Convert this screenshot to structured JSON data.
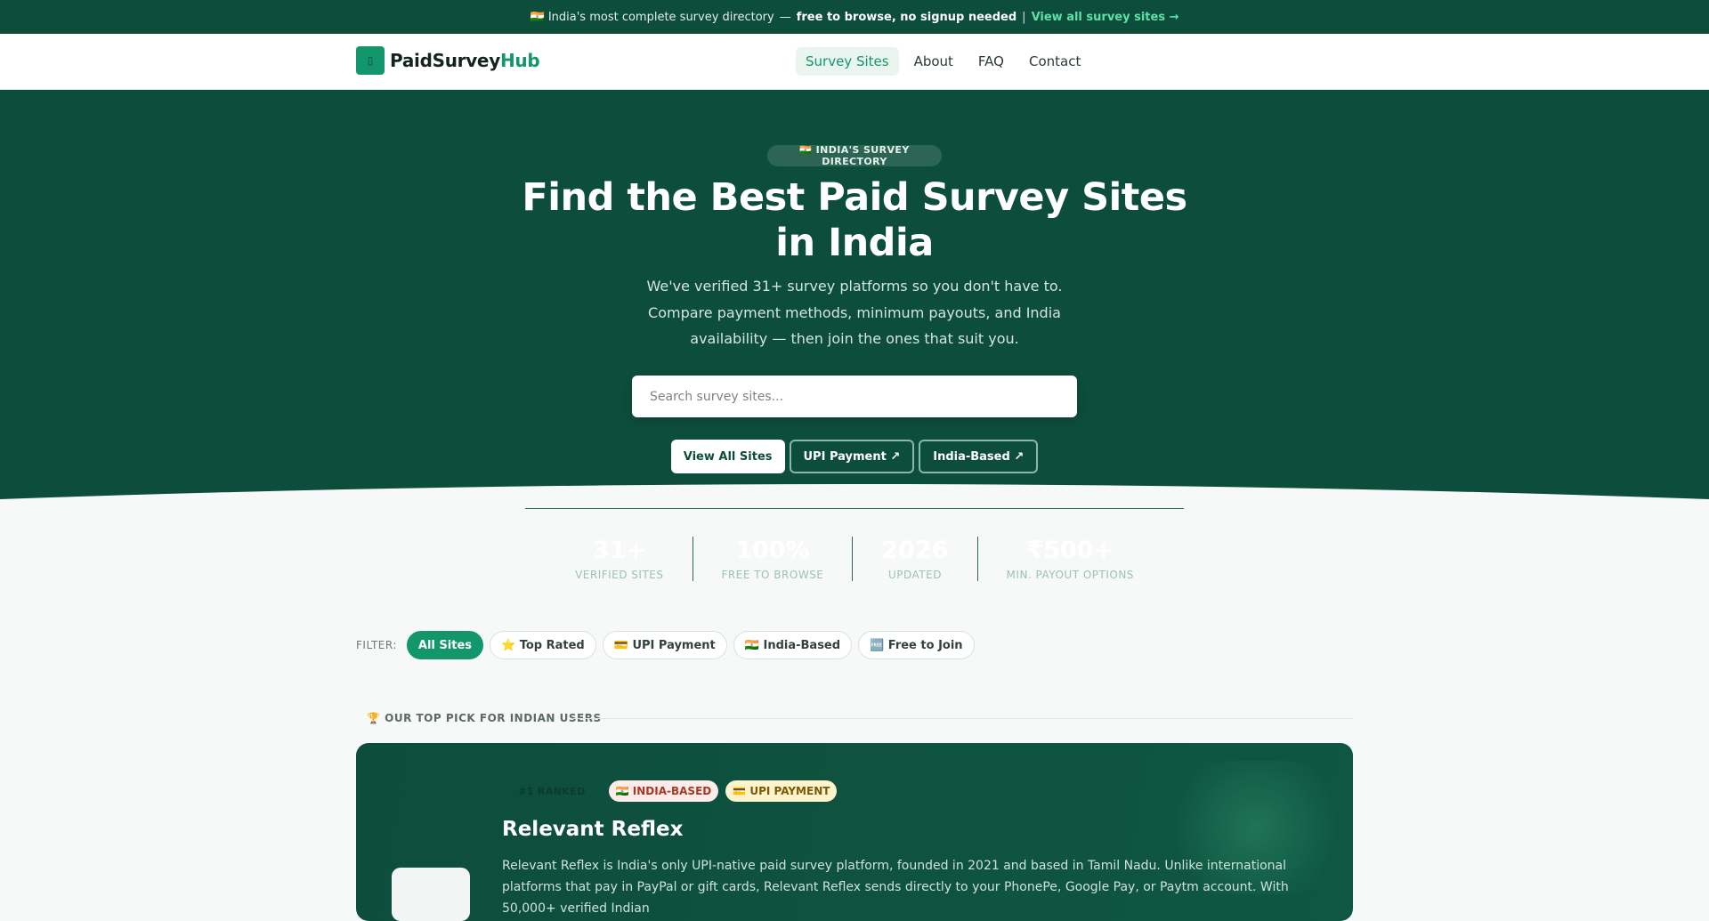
{
  "topbar": {
    "flag_icon": "india-flag-icon",
    "text": "🇮🇳 India's most complete survey directory",
    "dash": "—",
    "bold": "free to browse, no signup needed",
    "sep": "|",
    "link": "View all survey sites →"
  },
  "nav": {
    "logo_icon": "checklist-icon",
    "logo_glyph": "▯",
    "logo_main": "PaidSurvey",
    "logo_accent": "Hub",
    "links": [
      "Survey Sites",
      "About",
      "FAQ",
      "Contact"
    ]
  },
  "hero": {
    "badge": "🇮🇳 INDIA'S SURVEY DIRECTORY",
    "title": "Find the Best Paid Survey Sites in India",
    "subtitle": "We've verified 31+ survey platforms so you don't have to. Compare payment methods, minimum payouts, and India availability — then join the ones that suit you.",
    "search_placeholder": "Search survey sites...",
    "ctas": [
      "View All Sites",
      "UPI Payment ↗",
      "India-Based ↗"
    ],
    "stats": [
      {
        "num": "31+",
        "label": "VERIFIED SITES"
      },
      {
        "num": "100%",
        "label": "FREE TO BROWSE"
      },
      {
        "num": "2026",
        "label": "UPDATED"
      },
      {
        "num": "₹500+",
        "label": "MIN. PAYOUT OPTIONS"
      }
    ]
  },
  "filters": {
    "label": "FILTER:",
    "chips": [
      "All Sites",
      "⭐ Top Rated",
      "💳 UPI Payment",
      "🇮🇳 India-Based",
      "🆓 Free to Join"
    ]
  },
  "section": {
    "heading": "🏆 OUR TOP PICK FOR INDIAN USERS"
  },
  "card": {
    "ranked": "#1 RANKED",
    "tag_india": "🇮🇳 INDIA-BASED",
    "tag_upi": "💳 UPI PAYMENT",
    "title": "Relevant Reflex",
    "desc": "Relevant Reflex is India's only UPI-native paid survey platform, founded in 2021 and based in Tamil Nadu. Unlike international platforms that pay in PayPal or gift cards, Relevant Reflex sends directly to your PhonePe, Google Pay, or Paytm account. With 50,000+ verified Indian"
  },
  "colors": {
    "brand_dark": "#0d4d3b",
    "brand_accent": "#13966b",
    "link_accent": "#5ee0a8"
  }
}
